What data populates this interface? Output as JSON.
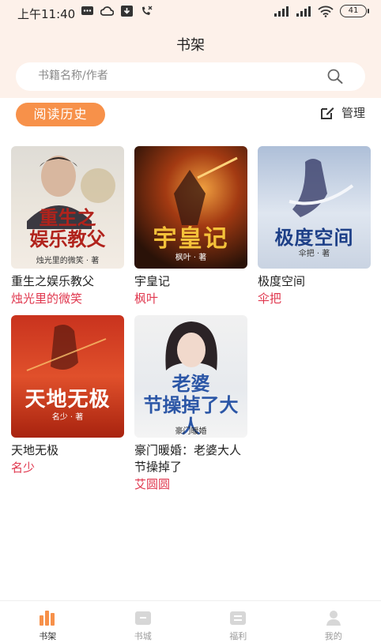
{
  "status": {
    "time": "上午11:40",
    "battery": "41",
    "icons": [
      "message-icon",
      "cloud-icon",
      "download-icon",
      "missed-call-icon",
      "signal-hd-icon",
      "signal-icon",
      "wifi-icon",
      "battery-icon"
    ]
  },
  "header": {
    "title": "书架"
  },
  "search": {
    "placeholder": "书籍名称/作者"
  },
  "toolbar": {
    "history_label": "阅读历史",
    "manage_label": "管理"
  },
  "books": [
    {
      "title": "重生之娱乐教父",
      "author": "烛光里的微笑",
      "cover_title": "重生之\n娱乐教父",
      "cover_author": "烛光里的微笑 · 著"
    },
    {
      "title": "宇皇记",
      "author": "枫叶",
      "cover_title": "宇皇记",
      "cover_author": "枫叶 · 著"
    },
    {
      "title": "极度空间",
      "author": "伞把",
      "cover_title": "极度空间",
      "cover_author": "伞把 · 著"
    },
    {
      "title": "天地无极",
      "author": "名少",
      "cover_title": "天地无极",
      "cover_author": "名少 · 著"
    },
    {
      "title": "豪门暖婚：老婆大人节操掉了",
      "author": "艾圆圆",
      "cover_title": "老婆\n节操掉了大人",
      "cover_author": "豪门暖婚"
    }
  ],
  "tabs": [
    {
      "label": "书架",
      "active": true
    },
    {
      "label": "书城",
      "active": false
    },
    {
      "label": "福利",
      "active": false
    },
    {
      "label": "我的",
      "active": false
    }
  ],
  "colors": {
    "accent": "#f7914a",
    "author": "#e0374e",
    "header_bg": "#fdf1ea"
  }
}
